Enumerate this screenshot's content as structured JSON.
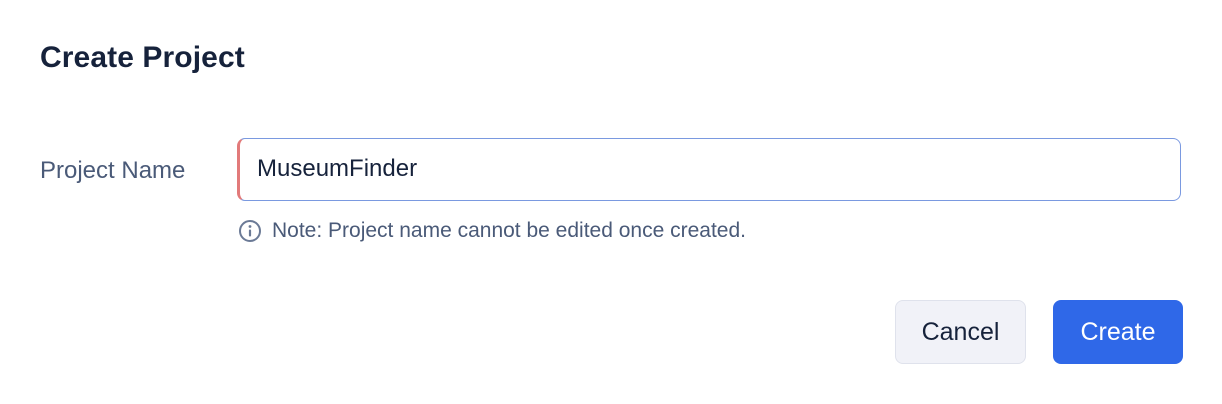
{
  "dialog": {
    "title": "Create Project",
    "field": {
      "label": "Project Name",
      "value": "MuseumFinder",
      "placeholder": ""
    },
    "note": {
      "icon": "info-icon",
      "text": "Note: Project name cannot be edited once created."
    },
    "buttons": {
      "cancel_label": "Cancel",
      "create_label": "Create"
    },
    "colors": {
      "title": "#16223b",
      "label": "#4a5a78",
      "input_border": "#7a99e0",
      "input_left_accent": "#e27a7a",
      "primary": "#2f68e8",
      "secondary_bg": "#f1f2f8"
    }
  }
}
